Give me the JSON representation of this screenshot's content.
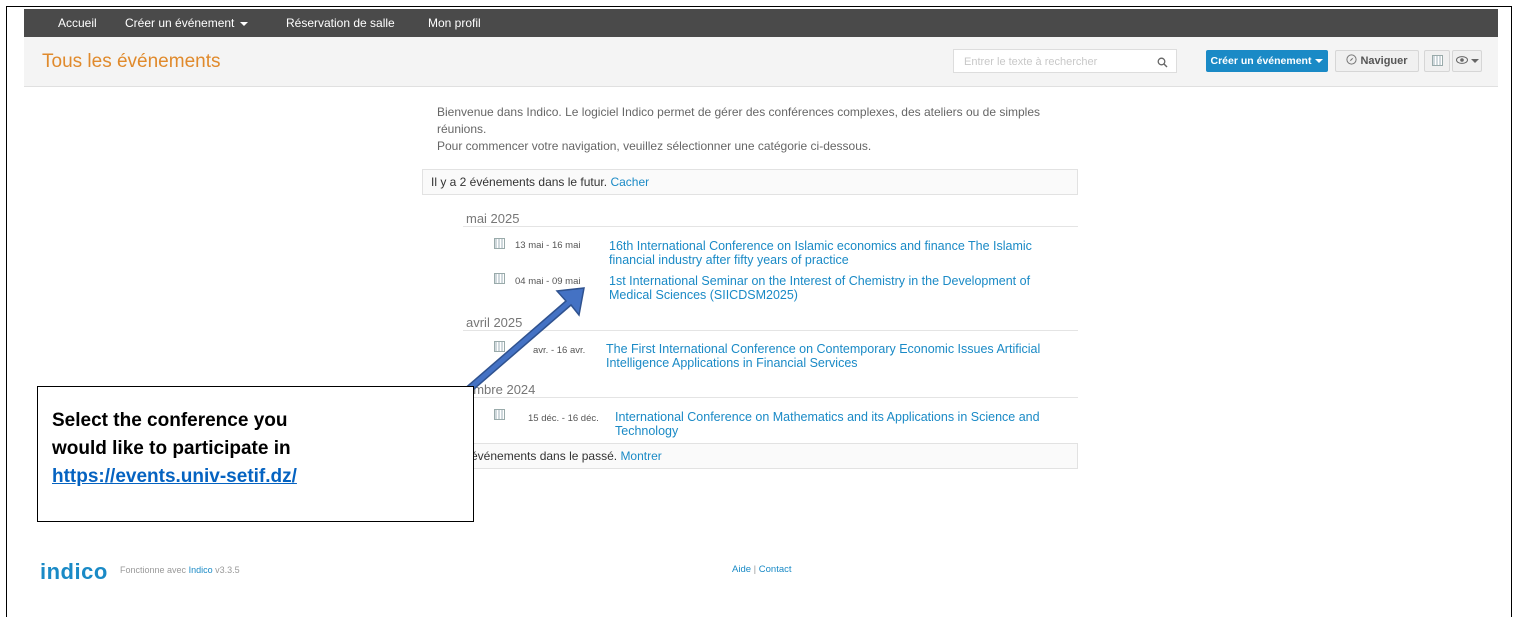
{
  "nav": {
    "items": [
      "Accueil",
      "Créer un événement",
      "Réservation de salle",
      "Mon profil"
    ]
  },
  "header": {
    "title": "Tous les événements",
    "search_placeholder": "Entrer le texte à rechercher",
    "create_label": "Créer un événement",
    "browse_label": "Naviguer"
  },
  "intro": {
    "line1": "Bienvenue dans Indico. Le logiciel Indico permet de gérer des conférences complexes, des ateliers ou de simples réunions.",
    "line2": "Pour commencer votre navigation, veuillez sélectionner une catégorie ci-dessous."
  },
  "future": {
    "text": "Il y a 2 événements dans le futur.",
    "link": "Cacher"
  },
  "past": {
    "text": "événements dans le passé.",
    "link": "Montrer"
  },
  "months": [
    "mai 2025",
    "avril 2025",
    "embre 2024"
  ],
  "events": [
    {
      "date": "13 mai - 16 mai",
      "title": "16th International Conference on Islamic economics and finance The Islamic financial industry after fifty years of practice"
    },
    {
      "date": "04 mai - 09 mai",
      "title": "1st International Seminar on the Interest of Chemistry in the Development of Medical Sciences (SIICDSM2025)"
    },
    {
      "date": "avr. - 16 avr.",
      "title": "The First International Conference on Contemporary Economic Issues Artificial Intelligence Applications in Financial Services"
    },
    {
      "date": "15 déc. - 16 déc.",
      "title": "International Conference on Mathematics and its Applications in Science and Technology"
    }
  ],
  "footer": {
    "logo": "indico",
    "powered_prefix": "Fonctionne avec",
    "powered_link": "Indico",
    "version": "v3.3.5",
    "help": "Aide",
    "separator": "|",
    "contact": "Contact"
  },
  "callout": {
    "line1": "Select the conference you",
    "line2": "would like to participate in",
    "url": "https://events.univ-setif.dz/"
  },
  "colors": {
    "accent": "#1a8ac6",
    "title": "#e08a2c",
    "topbar": "#4a4a4a",
    "arrow": "#4472c4"
  }
}
